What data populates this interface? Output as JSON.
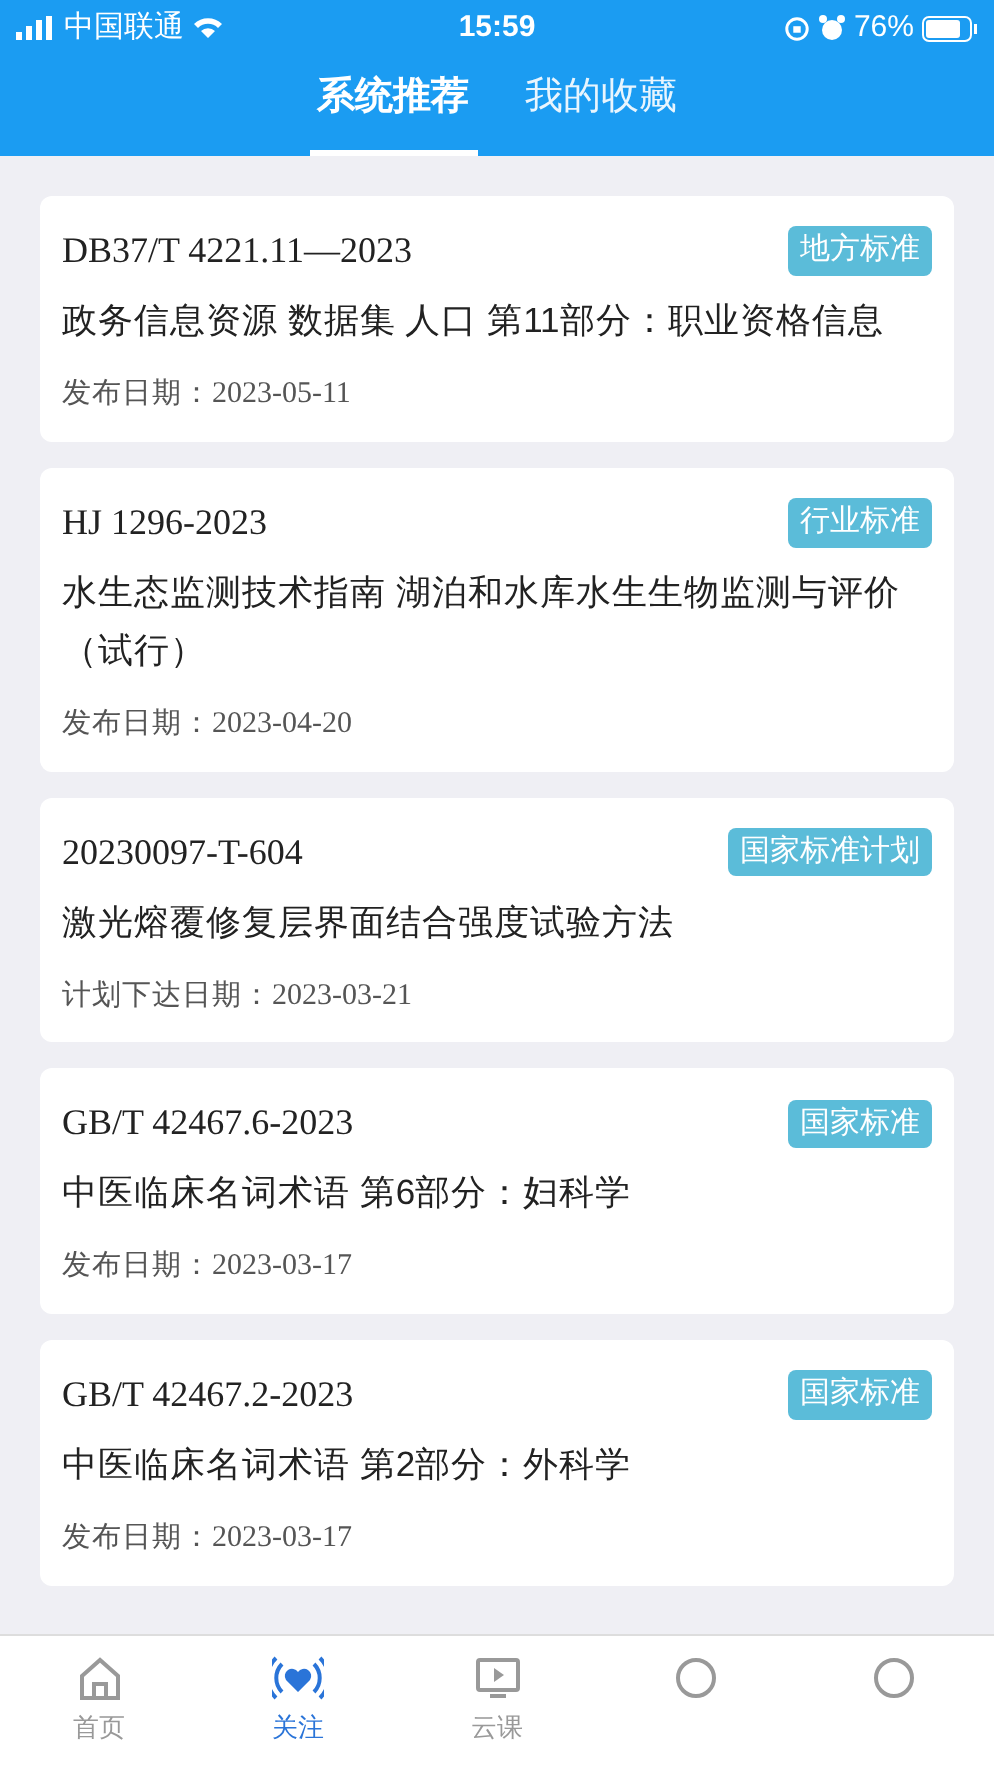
{
  "status_bar": {
    "carrier": "中国联通",
    "time": "15:59",
    "battery": "76%"
  },
  "tabs": [
    {
      "label": "系统推荐",
      "selected": true
    },
    {
      "label": "我的收藏",
      "selected": false
    }
  ],
  "cards": [
    {
      "code": "DB37/T 4221.11—2023",
      "tag": "地方标准",
      "title": "政务信息资源 数据集 人口 第11部分：职业资格信息",
      "date_label": "发布日期：",
      "date": "2023-05-11"
    },
    {
      "code": "HJ 1296-2023",
      "tag": "行业标准",
      "title": "水生态监测技术指南 湖泊和水库水生生物监测与评价（试行）",
      "date_label": "发布日期：",
      "date": "2023-04-20"
    },
    {
      "code": "20230097-T-604",
      "tag": "国家标准计划",
      "title": "激光熔覆修复层界面结合强度试验方法",
      "date_label": "计划下达日期：",
      "date": "2023-03-21"
    },
    {
      "code": "GB/T 42467.6-2023",
      "tag": "国家标准",
      "title": "中医临床名词术语 第6部分：妇科学",
      "date_label": "发布日期：",
      "date": "2023-03-17"
    },
    {
      "code": "GB/T 42467.2-2023",
      "tag": "国家标准",
      "title": "中医临床名词术语 第2部分：外科学",
      "date_label": "发布日期：",
      "date": "2023-03-17"
    }
  ],
  "nav": [
    {
      "kind": "home",
      "label": "首页",
      "selected": false
    },
    {
      "kind": "follow",
      "label": "关注",
      "selected": true
    },
    {
      "kind": "course",
      "label": "云课",
      "selected": false
    },
    {
      "kind": "hidden"
    },
    {
      "kind": "hidden"
    }
  ]
}
